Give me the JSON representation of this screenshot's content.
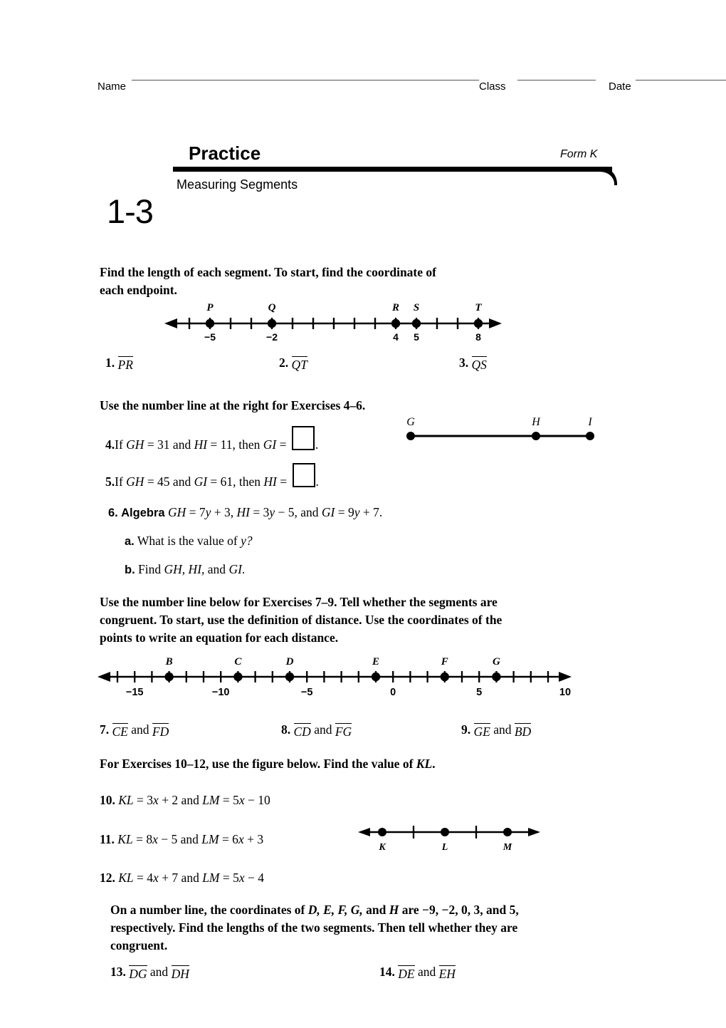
{
  "header": {
    "name_label": "Name",
    "class_label": "Class",
    "date_label": "Date",
    "practice_title": "Practice",
    "form_label": "Form K",
    "lesson_subtitle": "Measuring Segments",
    "lesson_number": "1-3"
  },
  "sections": {
    "instr1_line1": "Find the length of each segment. To start, find the coordinate of",
    "instr1_line2": "each endpoint.",
    "instr2": "Use the number line at the right for Exercises 4–6.",
    "instr3_line1": "Use the number line below for Exercises 7–9. Tell whether the segments are",
    "instr3_line2": "congruent. To start, use the definition of distance. Use the coordinates of the",
    "instr3_line3": "points to write an equation for each distance.",
    "instr4": "For Exercises 10–12, use the figure below. Find the value of KL.",
    "instr4_plain": "For Exercises 10–12, use the figure below. Find the value of ",
    "instr4_italic": "KL",
    "instr4_period": ".",
    "instr5_line1_a": "On a number line, the coordinates of ",
    "instr5_line1_b": "D, E, F, G,",
    "instr5_line1_c": " and ",
    "instr5_line1_d": "H",
    "instr5_line1_e": " are −9, −2, 0, 3, and 5,",
    "instr5_line2": "respectively. Find the lengths of the two segments. Then tell whether they are",
    "instr5_line3": "congruent."
  },
  "exercises": {
    "e1": {
      "number": "1.",
      "segment": "PR"
    },
    "e2": {
      "number": "2.",
      "segment": "QT"
    },
    "e3": {
      "number": "3.",
      "segment": "QS"
    },
    "e4": {
      "number": "4.",
      "pre": "If ",
      "v1": "GH",
      "mid1": " = 31 and ",
      "v2": "HI",
      "mid2": " = 11, then ",
      "v3": "GI",
      "eq": " = ",
      "post": "."
    },
    "e5": {
      "number": "5.",
      "pre": "If ",
      "v1": "GH",
      "mid1": " = 45 and ",
      "v2": "GI",
      "mid2": " = 61, then ",
      "v3": "HI",
      "eq": " = ",
      "post": "."
    },
    "e6": {
      "number": "6.",
      "tag": "Algebra",
      "body_v1": "GH",
      "body_1": " = 7",
      "body_y1": "y",
      "body_2": " + 3, ",
      "body_v2": "HI",
      "body_3": " = 3",
      "body_y2": "y",
      "body_4": " − 5, and ",
      "body_v3": "GI",
      "body_5": " = 9",
      "body_y3": "y",
      "body_6": " + 7.",
      "a_label": "a.",
      "a_text_pre": "What is the value of ",
      "a_text_var": "y?",
      "b_label": "b.",
      "b_text_pre": "Find ",
      "b_text_var": "GH, HI,",
      "b_text_mid": " and ",
      "b_text_var2": "GI",
      "b_text_post": "."
    },
    "e7": {
      "number": "7.",
      "seg_a": "CE",
      "and": "and",
      "seg_b": "FD"
    },
    "e8": {
      "number": "8.",
      "seg_a": "CD",
      "and": "and",
      "seg_b": "FG"
    },
    "e9": {
      "number": "9.",
      "seg_a": "GE",
      "and": "and",
      "seg_b": "BD"
    },
    "e10": {
      "number": "10.",
      "v1": "KL",
      "t1": " = 3",
      "x1": "x",
      "t2": " + 2 and ",
      "v2": "LM",
      "t3": " = 5",
      "x2": "x",
      "t4": " − 10"
    },
    "e11": {
      "number": "11.",
      "v1": "KL",
      "t1": " = 8",
      "x1": "x",
      "t2": " − 5 and ",
      "v2": "LM",
      "t3": " = 6",
      "x2": "x",
      "t4": " + 3"
    },
    "e12": {
      "number": "12.",
      "v1": "KL",
      "t1": " = 4",
      "x1": "x",
      "t2": " + 7 and ",
      "v2": "LM",
      "t3": " = 5",
      "x2": "x",
      "t4": " − 4"
    },
    "e13": {
      "number": "13.",
      "seg_a": "DG",
      "and": "and",
      "seg_b": "DH"
    },
    "e14": {
      "number": "14.",
      "seg_a": "DE",
      "and": "and",
      "seg_b": "EH"
    }
  },
  "figures": {
    "numberline_pqrst": {
      "name": "number-line-PQRST",
      "min": -6,
      "max": 9,
      "tick_values": [
        -6,
        -5,
        -4,
        -3,
        -2,
        -1,
        0,
        1,
        2,
        3,
        4,
        5,
        6,
        7,
        8,
        9
      ],
      "points": [
        {
          "label": "P",
          "value": -5,
          "tick_label": "−5"
        },
        {
          "label": "Q",
          "value": -2,
          "tick_label": "−2"
        },
        {
          "label": "R",
          "value": 4,
          "tick_label": "4"
        },
        {
          "label": "S",
          "value": 5,
          "tick_label": "5"
        },
        {
          "label": "T",
          "value": 8,
          "tick_label": "8"
        }
      ],
      "arrows": "both"
    },
    "segment_ghi": {
      "name": "segment-figure-GHI",
      "points": [
        {
          "label": "G",
          "pos": 0
        },
        {
          "label": "H",
          "pos": 0.7
        },
        {
          "label": "I",
          "pos": 1
        }
      ]
    },
    "numberline_bcdefg": {
      "name": "number-line-BCDEFG",
      "min": -16,
      "max": 11,
      "labeled_ticks": [
        {
          "value": -15,
          "text": "−15"
        },
        {
          "value": -10,
          "text": "−10"
        },
        {
          "value": -5,
          "text": "−5"
        },
        {
          "value": 0,
          "text": "0"
        },
        {
          "value": 5,
          "text": "5"
        },
        {
          "value": 10,
          "text": "10"
        }
      ],
      "points": [
        {
          "label": "B",
          "value": -13
        },
        {
          "label": "C",
          "value": -9
        },
        {
          "label": "D",
          "value": -6
        },
        {
          "label": "E",
          "value": -1
        },
        {
          "label": "F",
          "value": 3
        },
        {
          "label": "G",
          "value": 6
        }
      ],
      "arrows": "both"
    },
    "numberline_klm": {
      "name": "number-line-KLM",
      "points": [
        {
          "label": "K",
          "pos": 0.13
        },
        {
          "label": "L",
          "pos": 0.48
        },
        {
          "label": "M",
          "pos": 0.83
        }
      ],
      "ticks": [
        0.305,
        0.655
      ],
      "arrows": "both"
    }
  },
  "colors": {
    "ink": "#000000",
    "rule_gray": "#555555",
    "page_bg": "#ffffff"
  }
}
